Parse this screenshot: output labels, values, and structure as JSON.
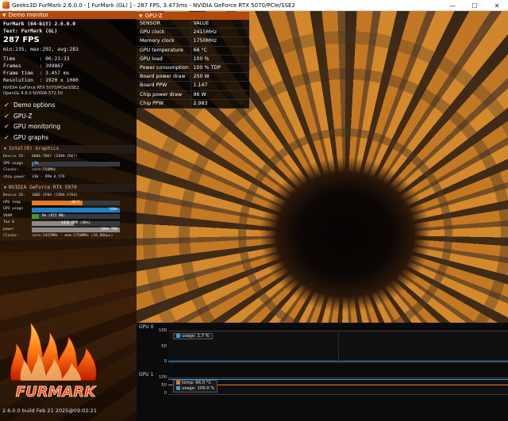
{
  "window": {
    "title": "Geeks3D FurMark 2.6.0.0 - [ FurMark (GL) ] - 287 FPS, 3.473ms - NVIDIA GeForce RTX 5070/PCIe/SSE2",
    "minimize": "—",
    "maximize": "☐",
    "close": "✕"
  },
  "demo_monitor": {
    "header": "Demo monitor",
    "app_name": "FurMark (64-bit) 2.6.0.0",
    "test": "Test: FurMark (GL)",
    "fps": "287 FPS",
    "fps_stats": "min:235, max:292, avg:283",
    "time": "Time        : 00:23:33",
    "frames": "Frames      : 399867",
    "frame_time": "Frame time  : 3.457 ms",
    "resolution": "Resolution  : 1920 x 1080",
    "renderer": "NVIDIA GeForce RTX 5070/PCIe/SSE2",
    "opengl": "OpenGL 4.6.0 NVIDIA 572.50"
  },
  "options": [
    {
      "label": "Demo options",
      "checked": true
    },
    {
      "label": "GPU-Z",
      "checked": true
    },
    {
      "label": "GPU monitoring",
      "checked": true
    },
    {
      "label": "GPU graphs",
      "checked": true
    }
  ],
  "intel_gpu": {
    "header": "Intel(R) Graphics",
    "device_id_label": "Device ID:",
    "device_id": "8086-7D67 (1849-7D67)",
    "usage_label": "GPU usage",
    "usage_text": "2%",
    "usage_pct": 2,
    "clocks_label": "Clocks:",
    "clocks": "core:550MHz",
    "chip_power_label": "chip power",
    "chip_power": "33W - PPW 8.579"
  },
  "nvidia_gpu": {
    "header": "NVIDIA GeForce RTX 5070",
    "device_id_label": "Device ID:",
    "device_id": "10DE-2F04 (19DA-1764)",
    "temp_label": "GPU temp",
    "temp_text": "66°C",
    "temp_pct": 58,
    "usage_label": "GPU usage",
    "usage_text": "100%",
    "usage_pct": 100,
    "vram_label": "VRAM",
    "vram_text": "8% (972 MB)",
    "vram_pct": 8,
    "fan_label": "fan 0",
    "fan_text": "1438 RPM (48%)",
    "fan_pct": 48,
    "power_label": "power",
    "power_text": "100% TDP",
    "power_pct": 100,
    "clocks_label": "Clocks:",
    "clocks": "core:2415MHz - mem:1750MHz (16.0Gbps)"
  },
  "gpuz": {
    "header": "GPU-Z",
    "col_sensor": "SENSOR",
    "col_value": "VALUE",
    "rows": [
      {
        "sensor": "GPU clock",
        "value": "2415MHz"
      },
      {
        "sensor": "Memory clock",
        "value": "1750MHz"
      },
      {
        "sensor": "GPU temperature",
        "value": "66 °C"
      },
      {
        "sensor": "GPU load",
        "value": "100 %"
      },
      {
        "sensor": "Power consumption",
        "value": "100 % TDP"
      },
      {
        "sensor": "Board power draw",
        "value": "250 W"
      },
      {
        "sensor": "Board PPW",
        "value": "1.147"
      },
      {
        "sensor": "Chip power draw",
        "value": "96 W"
      },
      {
        "sensor": "Chip PPW",
        "value": "2.983"
      }
    ]
  },
  "graphs": {
    "gpu0": {
      "title": "GPU 0",
      "axis_top": "100",
      "axis_mid": "50",
      "axis_bottom": "0",
      "legend_usage": "usage: 1.7 %",
      "usage_color": "#3a9ad9"
    },
    "gpu1": {
      "title": "GPU 1",
      "axis_top": "100",
      "axis_mid": "50",
      "axis_bottom": "0",
      "legend_temp": "temp: 66.0 °C",
      "legend_usage": "usage: 100.0 %",
      "temp_color": "#e07b2a",
      "usage_color": "#3a9ad9"
    }
  },
  "logo_text": "FURMARK",
  "build_info": "2.6.0.0 build Feb 21 2025@09:02:21",
  "colors": {
    "accent": "#b24a0c",
    "bar_orange": "#e07b2a",
    "bar_blue": "#1e7fc8",
    "bar_green": "#3a9a3a",
    "bar_gray": "#8a8a8a"
  }
}
